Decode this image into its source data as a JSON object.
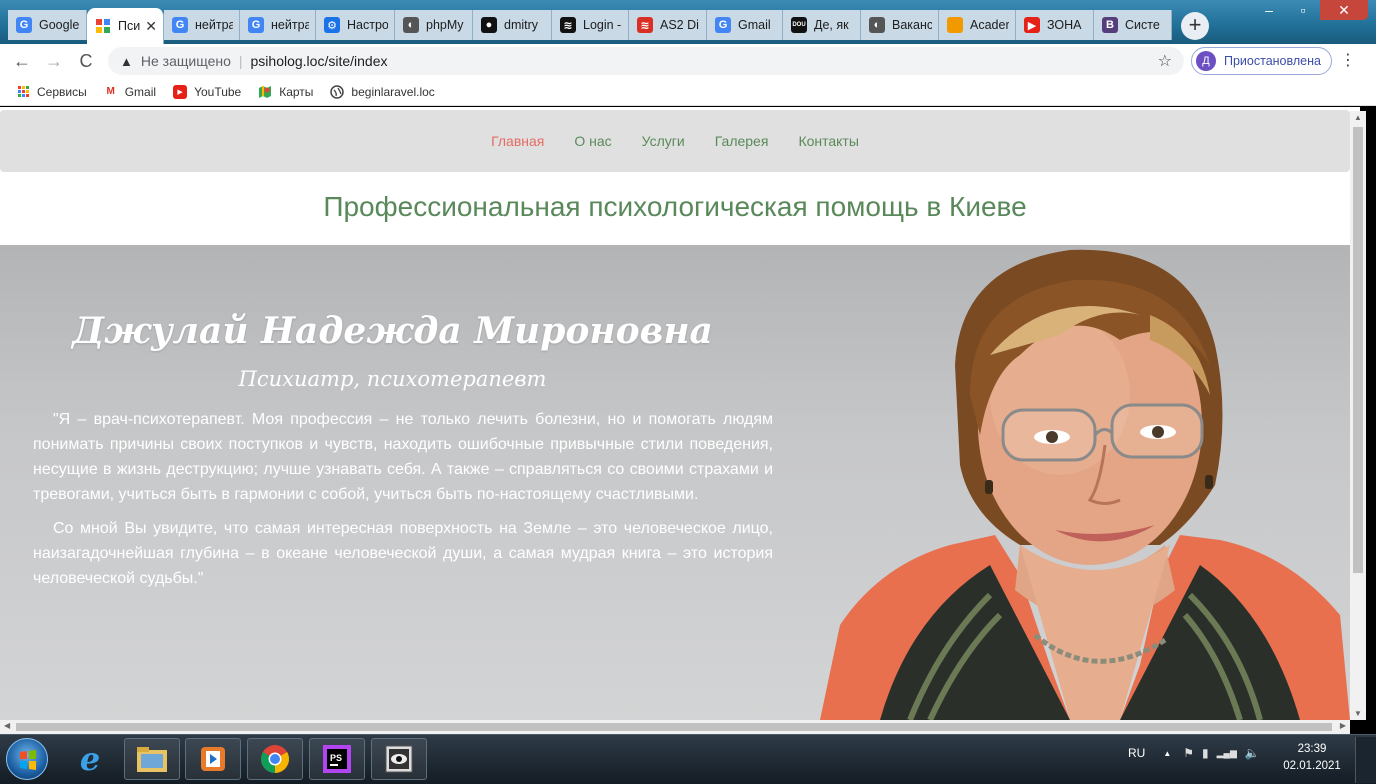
{
  "browser": {
    "tabs": [
      {
        "label": "Google",
        "icon": "google-docs-icon",
        "color": "#4285f4"
      },
      {
        "label": "Пси",
        "icon": "site-favicon-icon",
        "color": "#f4b400",
        "active": true
      },
      {
        "label": "нейтра",
        "icon": "google-icon",
        "color": "#4285f4"
      },
      {
        "label": "нейтра",
        "icon": "google-icon",
        "color": "#4285f4"
      },
      {
        "label": "Настро",
        "icon": "gear-icon",
        "color": "#1a73e8"
      },
      {
        "label": "phpMy",
        "icon": "globe-icon",
        "color": "#555555"
      },
      {
        "label": "dmitry",
        "icon": "github-icon",
        "color": "#111111"
      },
      {
        "label": "Login -",
        "icon": "as-logo-icon",
        "color": "#111111"
      },
      {
        "label": "AS2 Di",
        "icon": "as-logo-icon",
        "color": "#d93025"
      },
      {
        "label": "Gmail",
        "icon": "google-icon",
        "color": "#4285f4"
      },
      {
        "label": "Де, як",
        "icon": "dou-icon",
        "color": "#111111"
      },
      {
        "label": "Ваканс",
        "icon": "globe-icon",
        "color": "#555555"
      },
      {
        "label": "Acader",
        "icon": "academy-icon",
        "color": "#f29900"
      },
      {
        "label": "ЗОНА",
        "icon": "youtube-icon",
        "color": "#e62117"
      },
      {
        "label": "Систе",
        "icon": "bootstrap-icon",
        "color": "#563d7c"
      }
    ],
    "tab_glyphs": [
      "G",
      "",
      "G",
      "G",
      "⚙",
      "◐",
      "●",
      "≋",
      "≋",
      "G",
      "DOU",
      "◐",
      "",
      "▶",
      "B"
    ],
    "new_tab_label": "+",
    "window_controls": {
      "minimize": "–",
      "maximize": "▫",
      "close": "✕"
    },
    "tab_close": "✕",
    "insecure_label": "Не защищено",
    "url": "psiholog.loc/site/index",
    "profile_initial": "Д",
    "profile_label": "Приостановлена",
    "nav": {
      "back": "←",
      "forward": "→",
      "reload": "C"
    },
    "bookmarks": [
      {
        "label": "Сервисы",
        "icon": "apps-grid-icon"
      },
      {
        "label": "Gmail",
        "icon": "gmail-icon"
      },
      {
        "label": "YouTube",
        "icon": "youtube-icon"
      },
      {
        "label": "Карты",
        "icon": "maps-icon"
      },
      {
        "label": "beginlaravel.loc",
        "icon": "globe-icon"
      }
    ]
  },
  "page": {
    "nav": [
      {
        "label": "Главная",
        "active": true
      },
      {
        "label": "О нас"
      },
      {
        "label": "Услуги"
      },
      {
        "label": "Галерея"
      },
      {
        "label": "Контакты"
      }
    ],
    "headline": "Профессиональная психологическая помощь в Киеве",
    "hero": {
      "name": "Джулай Надежда Мироновна",
      "role": "Психиатр, психотерапевт",
      "paragraphs": [
        "\"Я – врач-психотерапевт. Моя профессия – не только лечить болезни, но и помогать людям понимать причины своих поступков и чувств, находить ошибочные привычные стили поведения, несущие в жизнь деструкцию; лучше узнавать себя. А также – справляться со своими страхами и тревогами, учиться быть в гармонии с собой, учиться быть по-настоящему счастливыми.",
        "Со мной Вы увидите, что самая интересная поверхность на Земле – это человеческое лицо, наизагадочнейшая глубина – в океане человеческой души, а самая мудрая книга – это история человеческой судьбы.\""
      ]
    },
    "colors": {
      "nav_link": "#5a8a5a",
      "nav_active": "#e46d63",
      "headline": "#59885a"
    }
  },
  "taskbar": {
    "apps": [
      "internet-explorer-icon",
      "file-explorer-icon",
      "media-player-icon",
      "chrome-icon",
      "phpstorm-icon",
      "screenshot-app-icon"
    ],
    "language": "RU",
    "tray_up": "▲",
    "tray_icons": [
      "flag-icon",
      "battery-icon",
      "network-icon",
      "volume-icon"
    ],
    "tray_glyphs": {
      "flag": "⚑",
      "battery": "▮",
      "network": "▂▄▆",
      "volume": "🔈"
    },
    "time": "23:39",
    "date": "02.01.2021"
  }
}
